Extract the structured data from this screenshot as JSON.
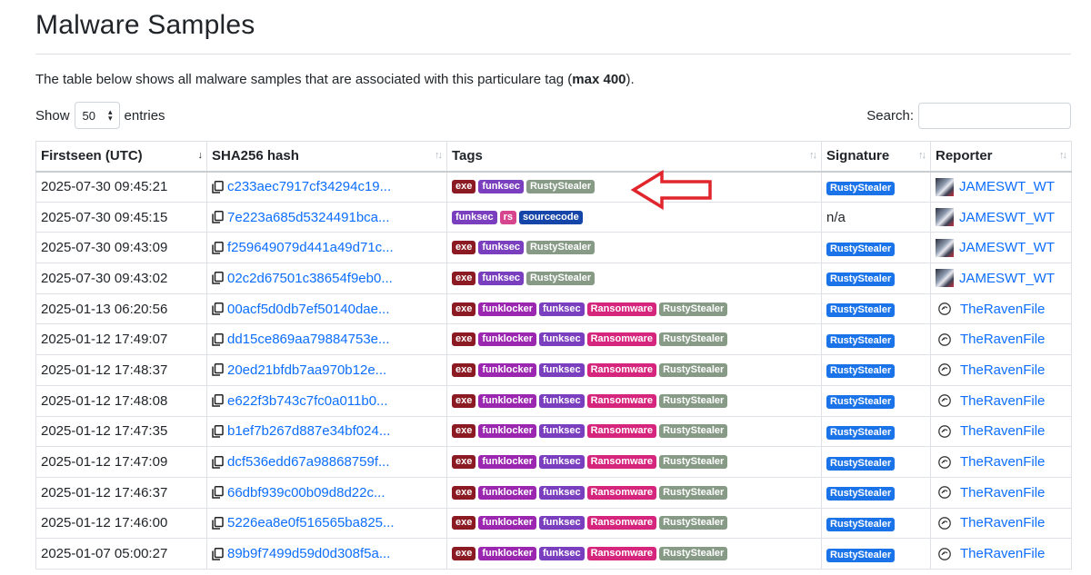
{
  "page": {
    "title": "Malware Samples",
    "intro_text": "The table below shows all malware samples that are associated with this particulare tag (",
    "intro_bold": "max 400",
    "intro_end": ")."
  },
  "controls": {
    "show_label": "Show",
    "entries_value": "50",
    "entries_label": "entries",
    "search_label": "Search:",
    "search_value": ""
  },
  "table": {
    "headers": [
      "Firstseen (UTC)",
      "SHA256 hash",
      "Tags",
      "Signature",
      "Reporter"
    ],
    "rows": [
      {
        "firstseen": "2025-07-30 09:45:21",
        "hash": "c233aec7917cf34294c19...",
        "tags": [
          "exe",
          "funksec",
          "RustyStealer"
        ],
        "signature": "RustyStealer",
        "reporter": "JAMESWT_WT",
        "reporter_icon": "avatar"
      },
      {
        "firstseen": "2025-07-30 09:45:15",
        "hash": "7e223a685d5324491bca...",
        "tags": [
          "funksec",
          "rs",
          "sourcecode"
        ],
        "signature": "n/a",
        "reporter": "JAMESWT_WT",
        "reporter_icon": "avatar"
      },
      {
        "firstseen": "2025-07-30 09:43:09",
        "hash": "f259649079d441a49d71c...",
        "tags": [
          "exe",
          "funksec",
          "RustyStealer"
        ],
        "signature": "RustyStealer",
        "reporter": "JAMESWT_WT",
        "reporter_icon": "avatar"
      },
      {
        "firstseen": "2025-07-30 09:43:02",
        "hash": "02c2d67501c38654f9eb0...",
        "tags": [
          "exe",
          "funksec",
          "RustyStealer"
        ],
        "signature": "RustyStealer",
        "reporter": "JAMESWT_WT",
        "reporter_icon": "avatar"
      },
      {
        "firstseen": "2025-01-13 06:20:56",
        "hash": "00acf5d0db7ef50140dae...",
        "tags": [
          "exe",
          "funklocker",
          "funksec",
          "Ransomware",
          "RustyStealer"
        ],
        "signature": "RustyStealer",
        "reporter": "TheRavenFile",
        "reporter_icon": "raven-icon"
      },
      {
        "firstseen": "2025-01-12 17:49:07",
        "hash": "dd15ce869aa79884753e...",
        "tags": [
          "exe",
          "funklocker",
          "funksec",
          "Ransomware",
          "RustyStealer"
        ],
        "signature": "RustyStealer",
        "reporter": "TheRavenFile",
        "reporter_icon": "raven-icon"
      },
      {
        "firstseen": "2025-01-12 17:48:37",
        "hash": "20ed21bfdb7aa970b12e...",
        "tags": [
          "exe",
          "funklocker",
          "funksec",
          "Ransomware",
          "RustyStealer"
        ],
        "signature": "RustyStealer",
        "reporter": "TheRavenFile",
        "reporter_icon": "raven-icon"
      },
      {
        "firstseen": "2025-01-12 17:48:08",
        "hash": "e622f3b743c7fc0a011b0...",
        "tags": [
          "exe",
          "funklocker",
          "funksec",
          "Ransomware",
          "RustyStealer"
        ],
        "signature": "RustyStealer",
        "reporter": "TheRavenFile",
        "reporter_icon": "raven-icon"
      },
      {
        "firstseen": "2025-01-12 17:47:35",
        "hash": "b1ef7b267d887e34bf024...",
        "tags": [
          "exe",
          "funklocker",
          "funksec",
          "Ransomware",
          "RustyStealer"
        ],
        "signature": "RustyStealer",
        "reporter": "TheRavenFile",
        "reporter_icon": "raven-icon"
      },
      {
        "firstseen": "2025-01-12 17:47:09",
        "hash": "dcf536edd67a98868759f...",
        "tags": [
          "exe",
          "funklocker",
          "funksec",
          "Ransomware",
          "RustyStealer"
        ],
        "signature": "RustyStealer",
        "reporter": "TheRavenFile",
        "reporter_icon": "raven-icon"
      },
      {
        "firstseen": "2025-01-12 17:46:37",
        "hash": "66dbf939c00b09d8d22c...",
        "tags": [
          "exe",
          "funklocker",
          "funksec",
          "Ransomware",
          "RustyStealer"
        ],
        "signature": "RustyStealer",
        "reporter": "TheRavenFile",
        "reporter_icon": "raven-icon"
      },
      {
        "firstseen": "2025-01-12 17:46:00",
        "hash": "5226ea8e0f516565ba825...",
        "tags": [
          "exe",
          "funklocker",
          "funksec",
          "Ransomware",
          "RustyStealer"
        ],
        "signature": "RustyStealer",
        "reporter": "TheRavenFile",
        "reporter_icon": "raven-icon"
      },
      {
        "firstseen": "2025-01-07 05:00:27",
        "hash": "89b9f7499d59d0d308f5a...",
        "tags": [
          "exe",
          "funklocker",
          "funksec",
          "Ransomware",
          "RustyStealer"
        ],
        "signature": "RustyStealer",
        "reporter": "TheRavenFile",
        "reporter_icon": "raven-icon"
      }
    ]
  },
  "tag_colors": {
    "exe": "#8b1a22",
    "funksec": "#7a3fbf",
    "funklocker": "#9b27b0",
    "Ransomware": "#d6257d",
    "RustyStealer": "#869a86",
    "rs": "#d6458e",
    "sourcecode": "#1545a8"
  },
  "colors": {
    "link": "#0d6efd",
    "signature_badge": "#1a73e8",
    "annotation_arrow": "#e0252c"
  },
  "annotation": {
    "icon": "left-arrow-icon",
    "points_to_row": 0
  }
}
